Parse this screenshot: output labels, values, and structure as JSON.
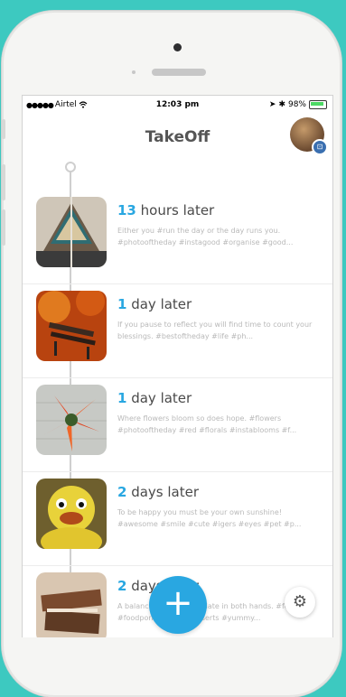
{
  "status_bar": {
    "signal_dots": "●●●●●",
    "carrier": "Airtel",
    "wifi_icon": "wifi-icon",
    "time": "12:03 pm",
    "location_icon": "➤",
    "bluetooth_icon": "✱",
    "battery": "98%"
  },
  "header": {
    "title": "TakeOff",
    "avatar_badge": "⊡"
  },
  "entries": [
    {
      "number": "13",
      "unit": " hours later",
      "description": "Either you #run the day or the day runs you. #photooftheday #instagood #organise #good..."
    },
    {
      "number": "1",
      "unit": " day later",
      "description": "If you pause to reflect you will find time to count your blessings. #bestoftheday #life #ph..."
    },
    {
      "number": "1",
      "unit": " day later",
      "description": "Where flowers bloom so does hope. #flowers #photooftheday #red #florals #instablooms #f..."
    },
    {
      "number": "2",
      "unit": " days later",
      "description": "To be happy you must be your own sunshine! #awesome #smile #cute #igers #eyes #pet #p..."
    },
    {
      "number": "2",
      "unit": " days later",
      "description": "A balanced diet is chocolate in both hands. #food #foodporn #yum #desserts #yummy..."
    }
  ],
  "fab_label": "+",
  "settings_icon": "⚙",
  "colors": {
    "background": "#3dc9c0",
    "accent": "#29a7e1"
  }
}
